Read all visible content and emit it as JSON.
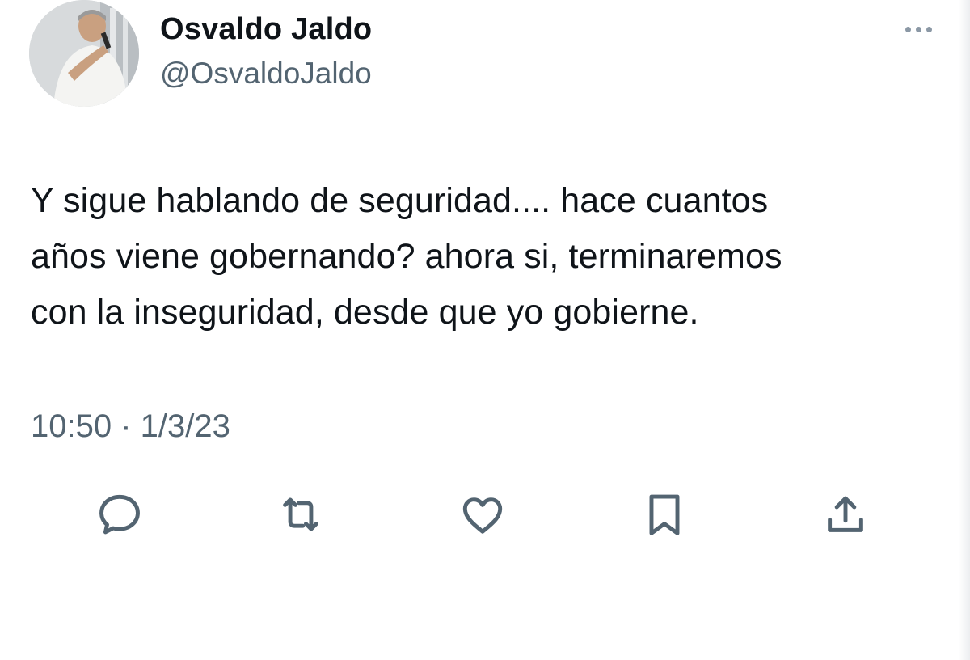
{
  "author": {
    "display_name": "Osvaldo Jaldo",
    "handle": "@OsvaldoJaldo",
    "avatar_icon": "profile-photo"
  },
  "tweet": {
    "text": "Y sigue hablando de seguridad.... hace cuantos\naños viene gobernando? ahora si, terminaremos\ncon la inseguridad, desde que yo gobierne.",
    "timestamp": "10:50 · 1/3/23"
  },
  "actions": [
    {
      "name": "reply",
      "icon": "speech-bubble-icon"
    },
    {
      "name": "retweet",
      "icon": "retweet-arrows-icon"
    },
    {
      "name": "like",
      "icon": "heart-icon"
    },
    {
      "name": "bookmark",
      "icon": "bookmark-icon"
    },
    {
      "name": "share",
      "icon": "share-upload-icon"
    }
  ],
  "colors": {
    "text_primary": "#0f1419",
    "text_secondary": "#536471",
    "icon_gray": "#536471"
  }
}
